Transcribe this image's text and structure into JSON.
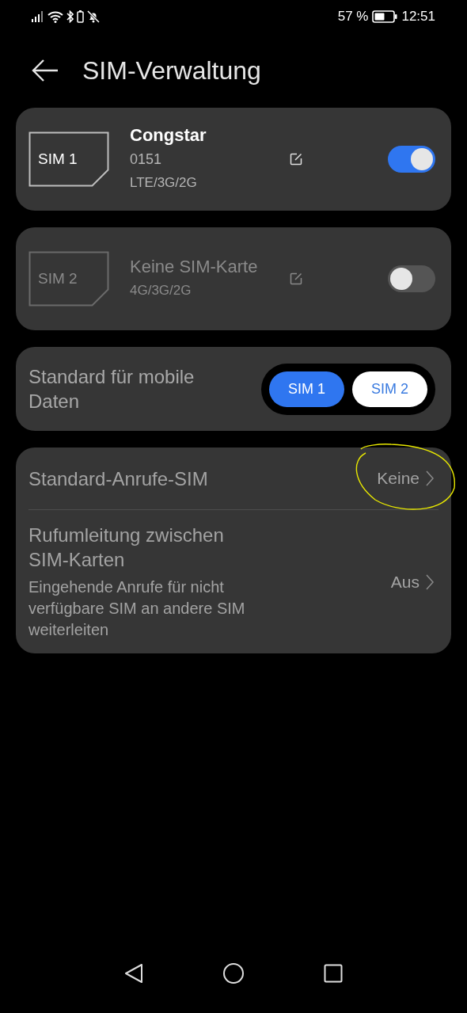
{
  "status_bar": {
    "battery_text": "57 %",
    "time": "12:51"
  },
  "header": {
    "title": "SIM-Verwaltung"
  },
  "sim_cards": [
    {
      "slot": "SIM 1",
      "name": "Congstar",
      "number": "0151",
      "network": "LTE/3G/2G",
      "on": true,
      "disabled": false
    },
    {
      "slot": "SIM 2",
      "name": "Keine SIM-Karte",
      "network": "4G/3G/2G",
      "on": false,
      "disabled": true
    }
  ],
  "mobile_data": {
    "label": "Standard für mobile Daten",
    "options": [
      {
        "label": "SIM 1",
        "selected": true
      },
      {
        "label": "SIM 2",
        "selected": false
      }
    ]
  },
  "settings": [
    {
      "title": "Standard-Anrufe-SIM",
      "value": "Keine",
      "disabled": true
    },
    {
      "title": "Rufumleitung zwischen SIM-Karten",
      "subtitle": "Eingehende Anrufe für nicht verfügbare SIM an andere SIM weiterleiten",
      "value": "Aus",
      "disabled": true
    }
  ]
}
